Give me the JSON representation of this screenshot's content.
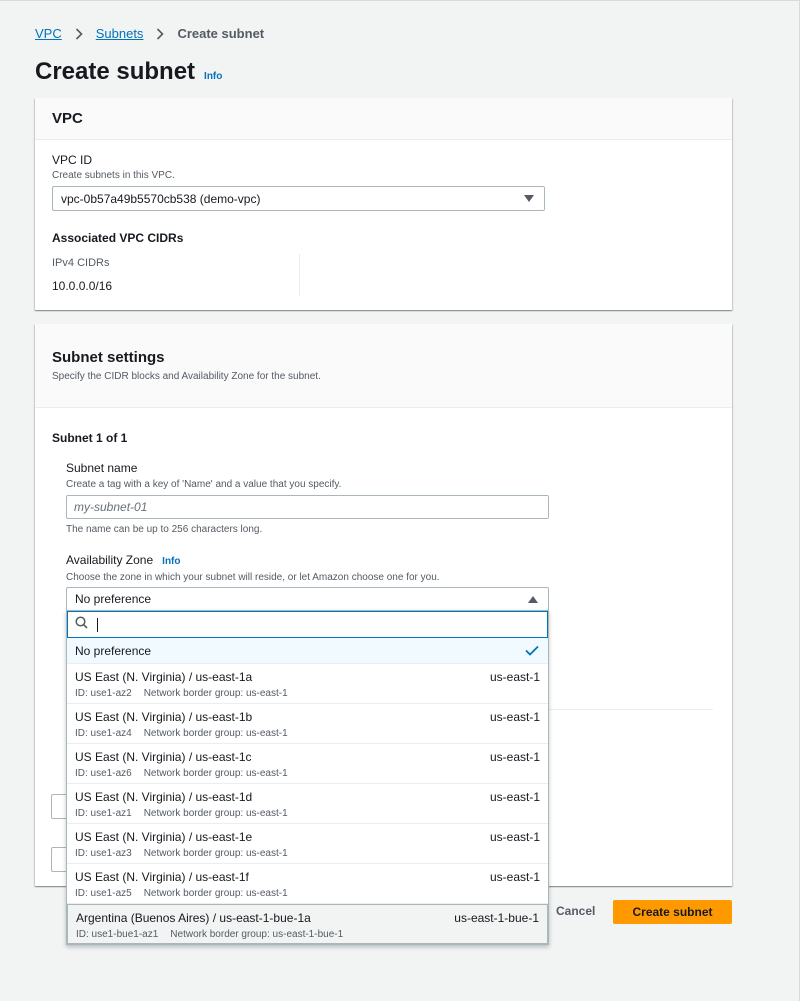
{
  "breadcrumb": {
    "items": [
      "VPC",
      "Subnets"
    ],
    "current": "Create subnet"
  },
  "page": {
    "title": "Create subnet",
    "info": "Info"
  },
  "vpc_panel": {
    "heading": "VPC",
    "vpc_id_label": "VPC ID",
    "vpc_id_desc": "Create subnets in this VPC.",
    "vpc_id_value": "vpc-0b57a49b5570cb538 (demo-vpc)",
    "cidr_heading": "Associated VPC CIDRs",
    "ipv4_label": "IPv4 CIDRs",
    "ipv4_value": "10.0.0.0/16"
  },
  "subnet_panel": {
    "heading": "Subnet settings",
    "desc": "Specify the CIDR blocks and Availability Zone for the subnet.",
    "subnet_counter": "Subnet 1 of 1",
    "name_label": "Subnet name",
    "name_desc": "Create a tag with a key of 'Name' and a value that you specify.",
    "name_placeholder": "my-subnet-01",
    "name_hint": "The name can be up to 256 characters long.",
    "az_label": "Availability Zone",
    "az_info": "Info",
    "az_desc": "Choose the zone in which your subnet will reside, or let Amazon choose one for you.",
    "az_value": "No preference"
  },
  "az_dropdown": {
    "no_pref": "No preference",
    "options": [
      {
        "name": "US East (N. Virginia) / us-east-1a",
        "region": "us-east-1",
        "id": "ID: use1-az2",
        "group": "Network border group: us-east-1"
      },
      {
        "name": "US East (N. Virginia) / us-east-1b",
        "region": "us-east-1",
        "id": "ID: use1-az4",
        "group": "Network border group: us-east-1"
      },
      {
        "name": "US East (N. Virginia) / us-east-1c",
        "region": "us-east-1",
        "id": "ID: use1-az6",
        "group": "Network border group: us-east-1"
      },
      {
        "name": "US East (N. Virginia) / us-east-1d",
        "region": "us-east-1",
        "id": "ID: use1-az1",
        "group": "Network border group: us-east-1"
      },
      {
        "name": "US East (N. Virginia) / us-east-1e",
        "region": "us-east-1",
        "id": "ID: use1-az3",
        "group": "Network border group: us-east-1"
      },
      {
        "name": "US East (N. Virginia) / us-east-1f",
        "region": "us-east-1",
        "id": "ID: use1-az5",
        "group": "Network border group: us-east-1"
      },
      {
        "name": "Argentina (Buenos Aires) / us-east-1-bue-1a",
        "region": "us-east-1-bue-1",
        "id": "ID: use1-bue1-az1",
        "group": "Network border group: us-east-1-bue-1"
      }
    ]
  },
  "actions": {
    "cancel": "Cancel",
    "create": "Create subnet"
  },
  "colors": {
    "link": "#0073bb",
    "primary": "#ff9900",
    "page_bg": "#f2f3f3"
  }
}
